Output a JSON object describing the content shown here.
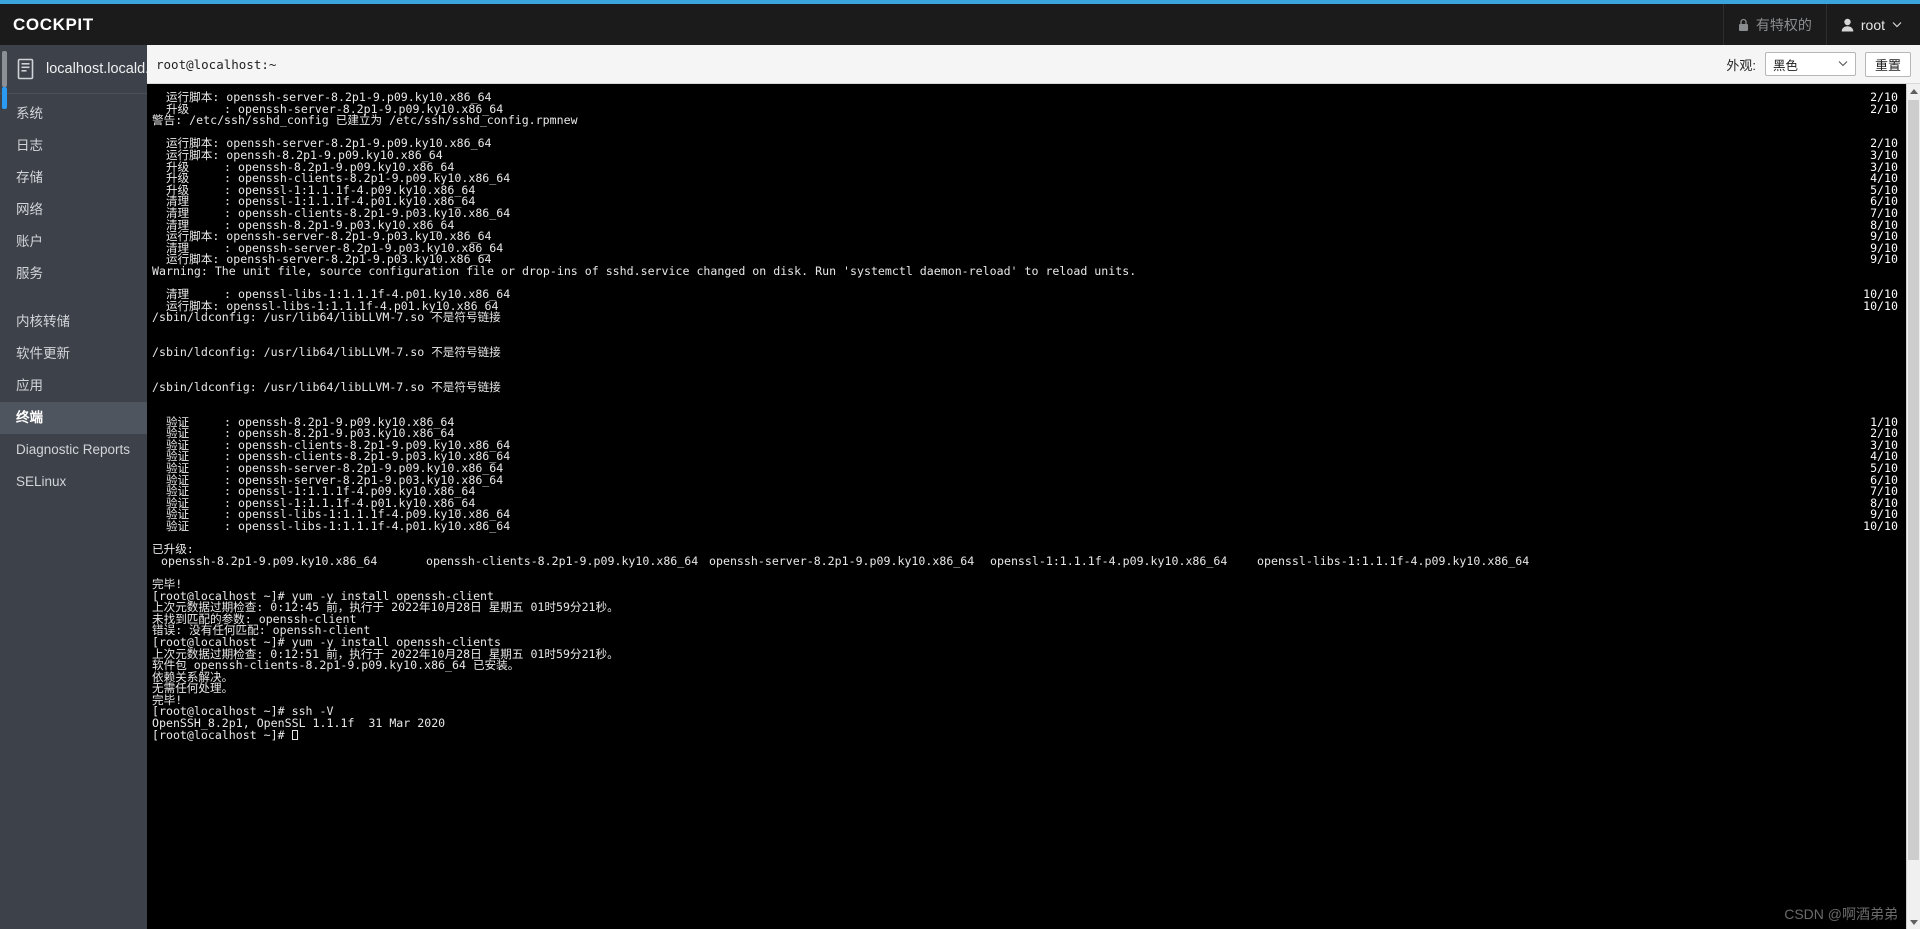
{
  "accent_color": "#39a5dc",
  "masthead": {
    "brand": "COCKPIT",
    "privileged_label": "有特权的",
    "privileged_icon": "lock-icon",
    "user_label": "root",
    "user_icon": "user-icon",
    "user_caret_icon": "chevron-down-icon"
  },
  "sidebar": {
    "host": {
      "label": "localhost.locald...",
      "icon": "server-icon"
    },
    "items": [
      {
        "label": "系统",
        "active": false
      },
      {
        "label": "日志",
        "active": false
      },
      {
        "label": "存储",
        "active": false
      },
      {
        "label": "网络",
        "active": false
      },
      {
        "label": "账户",
        "active": false
      },
      {
        "label": "服务",
        "active": false
      },
      {
        "label": "内核转储",
        "active": false
      },
      {
        "label": "软件更新",
        "active": false
      },
      {
        "label": "应用",
        "active": false
      },
      {
        "label": "终端",
        "active": true
      },
      {
        "label": "Diagnostic Reports",
        "active": false
      },
      {
        "label": "SELinux",
        "active": false
      }
    ]
  },
  "terminal_header": {
    "title": "root@localhost:~",
    "appearance_label": "外观:",
    "appearance_value": "黑色",
    "appearance_caret_icon": "chevron-down-icon",
    "reset_label": "重置"
  },
  "console": {
    "lines": [
      {
        "text": "  运行脚本: openssh-server-8.2p1-9.p09.ky10.x86_64",
        "count": "2/10"
      },
      {
        "text": "  升级     : openssh-server-8.2p1-9.p09.ky10.x86_64",
        "count": "2/10"
      },
      {
        "text": "警告: /etc/ssh/sshd_config 已建立为 /etc/ssh/sshd_config.rpmnew",
        "count": ""
      },
      {
        "text": "",
        "count": ""
      },
      {
        "text": "  运行脚本: openssh-server-8.2p1-9.p09.ky10.x86_64",
        "count": "2/10"
      },
      {
        "text": "  运行脚本: openssh-8.2p1-9.p09.ky10.x86_64",
        "count": "3/10"
      },
      {
        "text": "  升级     : openssh-8.2p1-9.p09.ky10.x86_64",
        "count": "3/10"
      },
      {
        "text": "  升级     : openssh-clients-8.2p1-9.p09.ky10.x86_64",
        "count": "4/10"
      },
      {
        "text": "  升级     : openssl-1:1.1.1f-4.p09.ky10.x86_64",
        "count": "5/10"
      },
      {
        "text": "  清理     : openssl-1:1.1.1f-4.p01.ky10.x86_64",
        "count": "6/10"
      },
      {
        "text": "  清理     : openssh-clients-8.2p1-9.p03.ky10.x86_64",
        "count": "7/10"
      },
      {
        "text": "  清理     : openssh-8.2p1-9.p03.ky10.x86_64",
        "count": "8/10"
      },
      {
        "text": "  运行脚本: openssh-server-8.2p1-9.p03.ky10.x86_64",
        "count": "9/10"
      },
      {
        "text": "  清理     : openssh-server-8.2p1-9.p03.ky10.x86_64",
        "count": "9/10"
      },
      {
        "text": "  运行脚本: openssh-server-8.2p1-9.p03.ky10.x86_64",
        "count": "9/10"
      },
      {
        "text": "Warning: The unit file, source configuration file or drop-ins of sshd.service changed on disk. Run 'systemctl daemon-reload' to reload units.",
        "count": ""
      },
      {
        "text": "",
        "count": ""
      },
      {
        "text": "  清理     : openssl-libs-1:1.1.1f-4.p01.ky10.x86_64",
        "count": "10/10"
      },
      {
        "text": "  运行脚本: openssl-libs-1:1.1.1f-4.p01.ky10.x86_64",
        "count": "10/10"
      },
      {
        "text": "/sbin/ldconfig: /usr/lib64/libLLVM-7.so 不是符号链接",
        "count": ""
      },
      {
        "text": "",
        "count": ""
      },
      {
        "text": "",
        "count": ""
      },
      {
        "text": "/sbin/ldconfig: /usr/lib64/libLLVM-7.so 不是符号链接",
        "count": ""
      },
      {
        "text": "",
        "count": ""
      },
      {
        "text": "",
        "count": ""
      },
      {
        "text": "/sbin/ldconfig: /usr/lib64/libLLVM-7.so 不是符号链接",
        "count": ""
      },
      {
        "text": "",
        "count": ""
      },
      {
        "text": "",
        "count": ""
      },
      {
        "text": "  验证     : openssh-8.2p1-9.p09.ky10.x86_64",
        "count": "1/10"
      },
      {
        "text": "  验证     : openssh-8.2p1-9.p03.ky10.x86_64",
        "count": "2/10"
      },
      {
        "text": "  验证     : openssh-clients-8.2p1-9.p09.ky10.x86_64",
        "count": "3/10"
      },
      {
        "text": "  验证     : openssh-clients-8.2p1-9.p03.ky10.x86_64",
        "count": "4/10"
      },
      {
        "text": "  验证     : openssh-server-8.2p1-9.p09.ky10.x86_64",
        "count": "5/10"
      },
      {
        "text": "  验证     : openssh-server-8.2p1-9.p03.ky10.x86_64",
        "count": "6/10"
      },
      {
        "text": "  验证     : openssl-1:1.1.1f-4.p09.ky10.x86_64",
        "count": "7/10"
      },
      {
        "text": "  验证     : openssl-1:1.1.1f-4.p01.ky10.x86_64",
        "count": "8/10"
      },
      {
        "text": "  验证     : openssl-libs-1:1.1.1f-4.p09.ky10.x86_64",
        "count": "9/10"
      },
      {
        "text": "  验证     : openssl-libs-1:1.1.1f-4.p01.ky10.x86_64",
        "count": "10/10"
      },
      {
        "text": "",
        "count": ""
      },
      {
        "text": "已升级:",
        "count": ""
      }
    ],
    "upgraded_packages": [
      "openssh-8.2p1-9.p09.ky10.x86_64",
      "openssh-clients-8.2p1-9.p09.ky10.x86_64",
      "openssh-server-8.2p1-9.p09.ky10.x86_64",
      "openssl-1:1.1.1f-4.p09.ky10.x86_64",
      "openssl-libs-1:1.1.1f-4.p09.ky10.x86_64"
    ],
    "tail_lines": [
      "",
      "完毕!",
      "[root@localhost ~]# yum -y install openssh-client",
      "上次元数据过期检查: 0:12:45 前，执行于 2022年10月28日 星期五 01时59分21秒。",
      "未找到匹配的参数: openssh-client",
      "错误: 没有任何匹配: openssh-client",
      "[root@localhost ~]# yum -y install openssh-clients",
      "上次元数据过期检查: 0:12:51 前，执行于 2022年10月28日 星期五 01时59分21秒。",
      "软件包 openssh-clients-8.2p1-9.p09.ky10.x86_64 已安装。",
      "依赖关系解决。",
      "无需任何处理。",
      "完毕!",
      "[root@localhost ~]# ssh -V",
      "OpenSSH_8.2p1, OpenSSL 1.1.1f  31 Mar 2020"
    ],
    "prompt": "[root@localhost ~]# ",
    "scrollbar": {
      "up_icon": "triangle-up-icon",
      "down_icon": "triangle-down-icon"
    }
  },
  "watermark": "CSDN @啊酒弟弟"
}
